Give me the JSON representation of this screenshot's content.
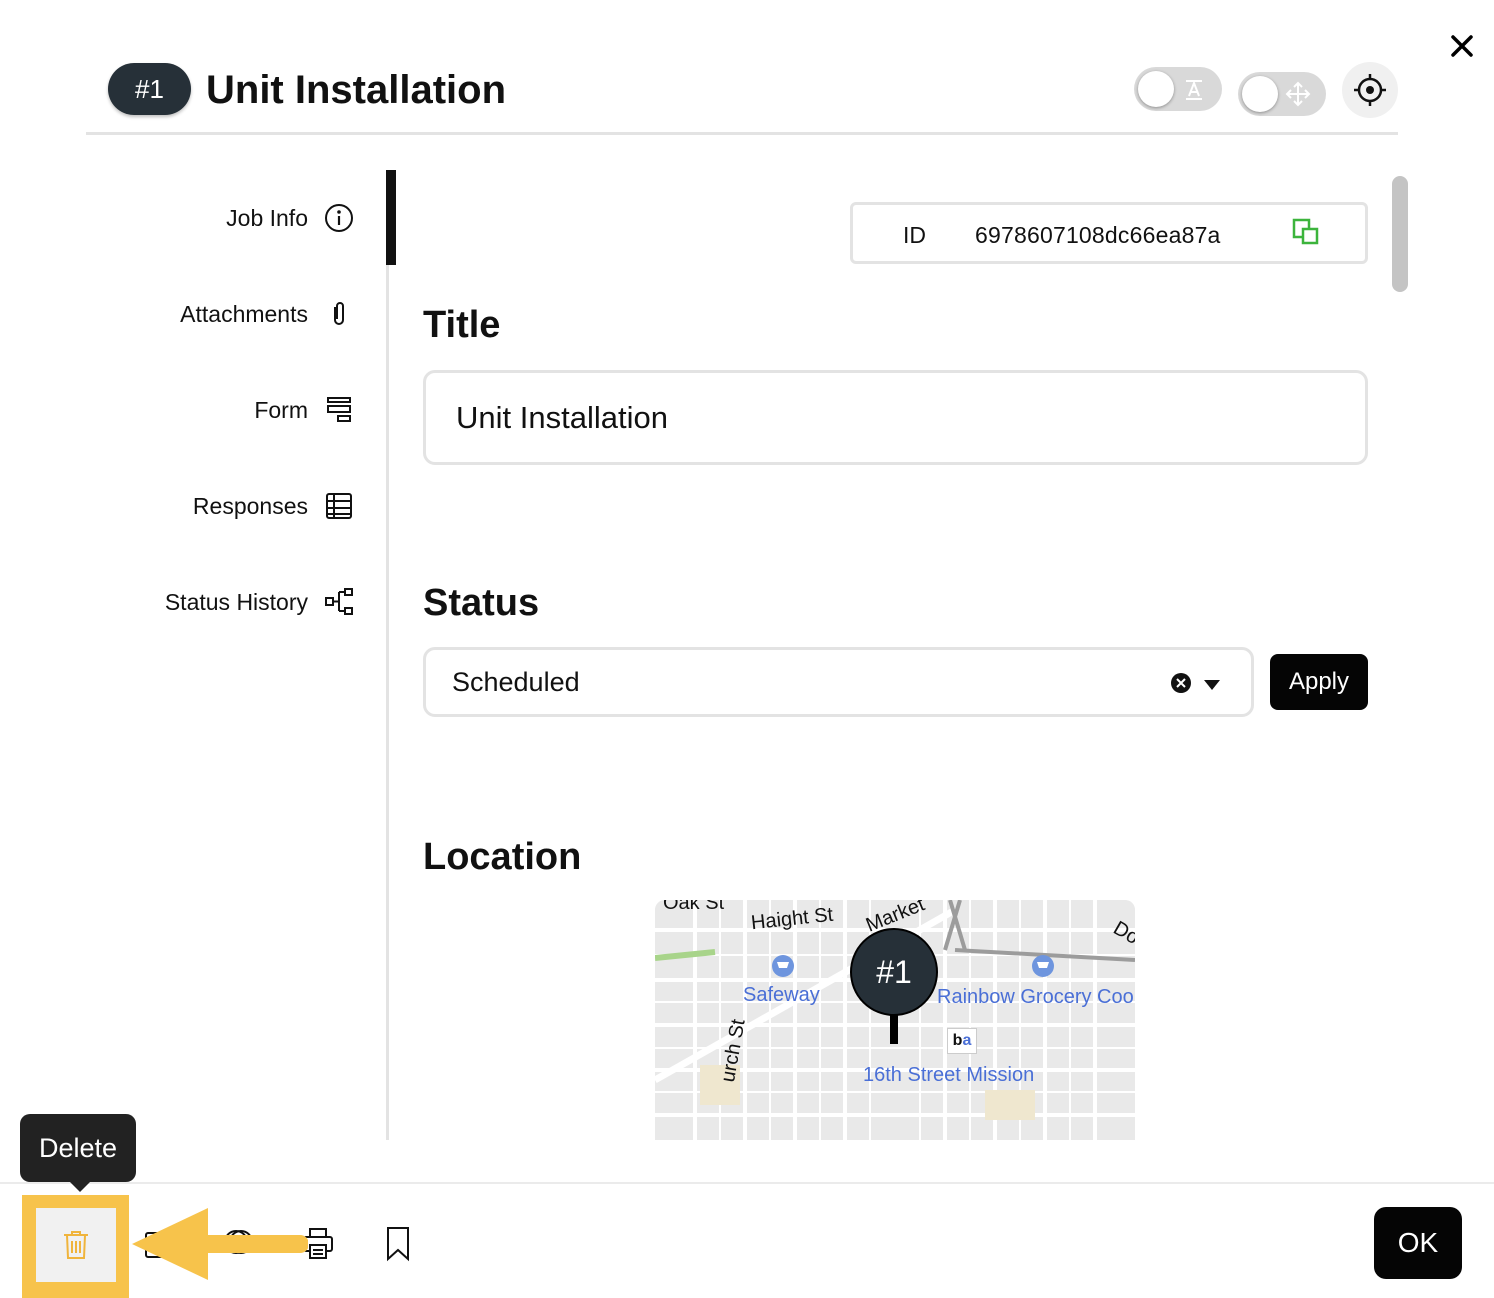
{
  "header": {
    "job_number": "#1",
    "title": "Unit Installation"
  },
  "nav": {
    "items": [
      {
        "label": "Job Info",
        "icon": "info-icon",
        "active": true
      },
      {
        "label": "Attachments",
        "icon": "paperclip-icon"
      },
      {
        "label": "Form",
        "icon": "form-icon"
      },
      {
        "label": "Responses",
        "icon": "table-icon"
      },
      {
        "label": "Status History",
        "icon": "flowchart-icon"
      }
    ]
  },
  "job_info": {
    "id_label": "ID",
    "id_value": "6978607108dc66ea87a",
    "title_heading": "Title",
    "title_value": "Unit Installation",
    "status_heading": "Status",
    "status_value": "Scheduled",
    "apply_label": "Apply",
    "location_heading": "Location"
  },
  "map": {
    "marker_label": "#1",
    "streets": [
      "Oak St",
      "Haight St",
      "Market",
      "Do",
      "urch St"
    ],
    "places": [
      "Safeway",
      "Rainbow Grocery Coo",
      "16th Street Mission"
    ]
  },
  "footer": {
    "tooltip": "Delete",
    "ok_label": "OK"
  },
  "colors": {
    "accent": "#f7c34b",
    "dark": "#263038",
    "copy_icon": "#3cb43c",
    "map_label": "#4a6fd6"
  }
}
